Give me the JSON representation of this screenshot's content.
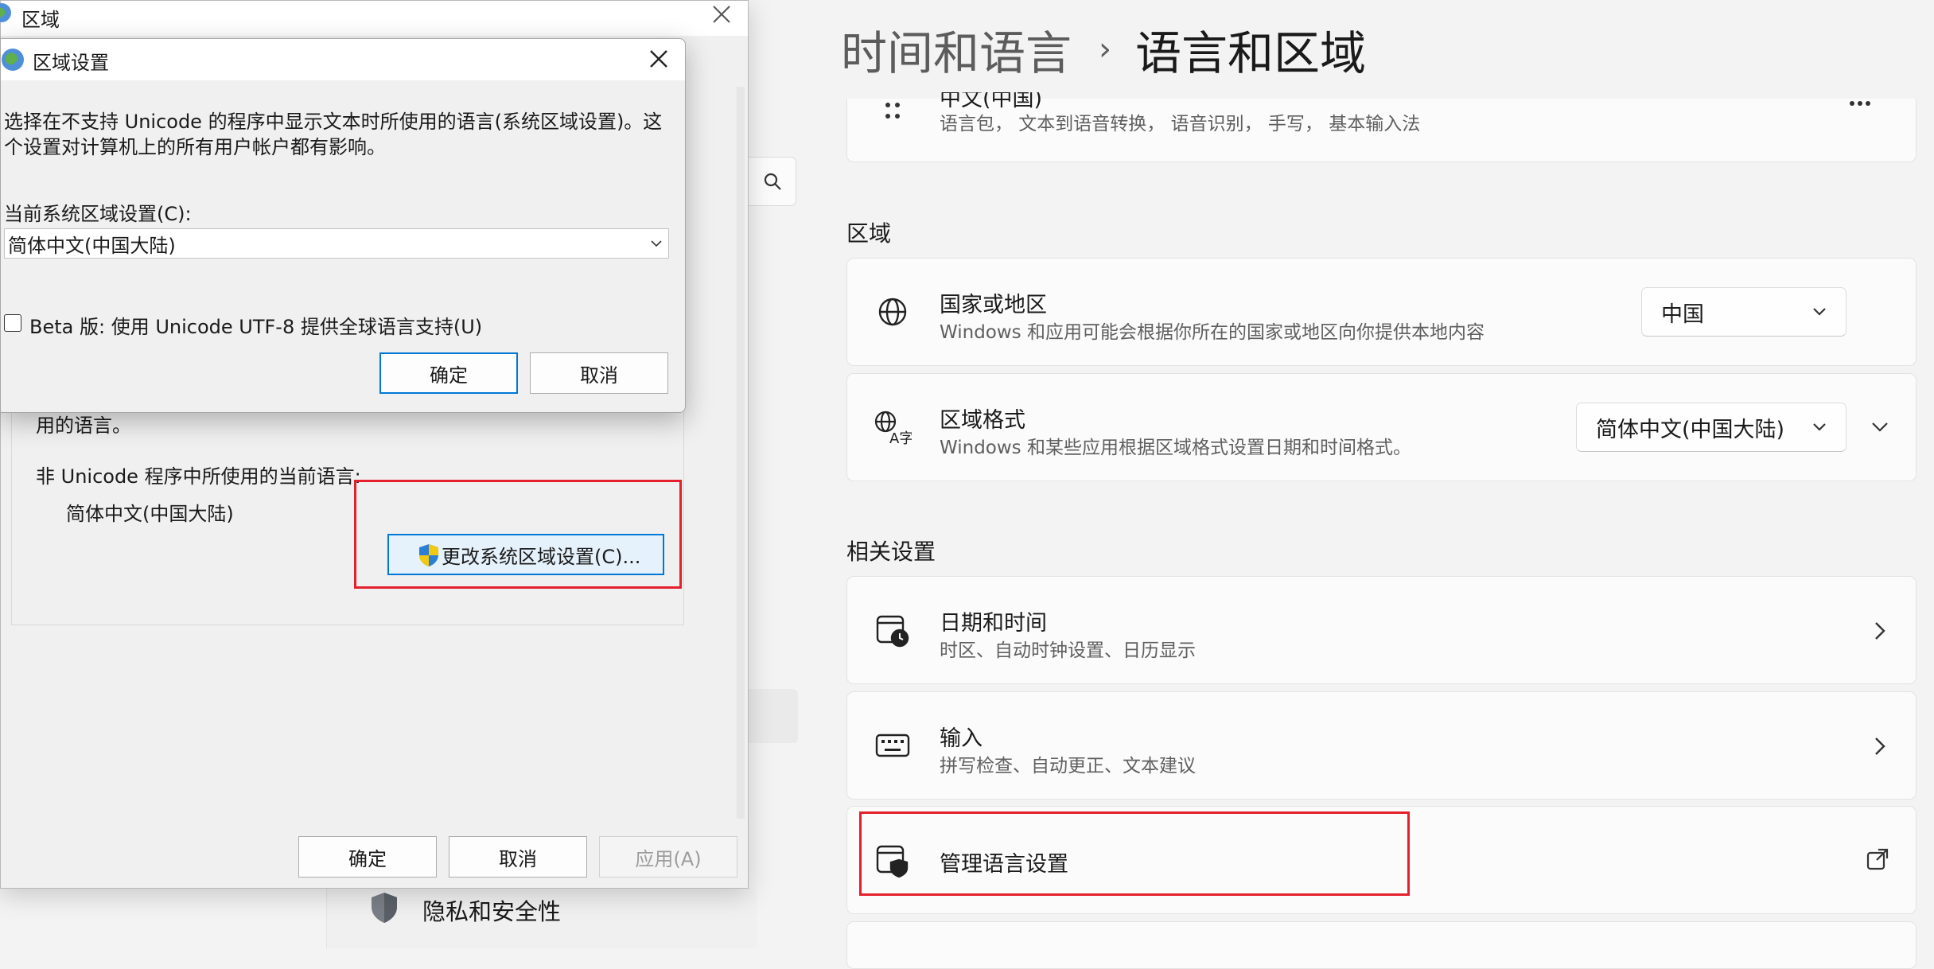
{
  "settings": {
    "breadcrumb": {
      "parent": "时间和语言",
      "separator": "›",
      "current": "语言和区域"
    },
    "language_card": {
      "title_partial": "中文(中国)",
      "subtitle": "语言包， 文本到语音转换， 语音识别， 手写， 基本输入法",
      "more_icon": "more-horizontal-icon"
    },
    "region_section_label": "区域",
    "country_card": {
      "title": "国家或地区",
      "subtitle": "Windows 和应用可能会根据你所在的国家或地区向你提供本地内容",
      "value": "中国"
    },
    "format_card": {
      "title": "区域格式",
      "subtitle": "Windows 和某些应用根据区域格式设置日期和时间格式。",
      "value": "简体中文(中国大陆)"
    },
    "related_section_label": "相关设置",
    "date_time_card": {
      "title": "日期和时间",
      "subtitle": "时区、自动时钟设置、日历显示"
    },
    "input_card": {
      "title": "输入",
      "subtitle": "拼写检查、自动更正、文本建议"
    },
    "manage_language_card": {
      "title": "管理语言设置"
    },
    "sidebar_privacy": "隐私和安全性"
  },
  "region_window": {
    "title": "区域",
    "partial_text": "用的语言。",
    "current_lang_label": "非 Unicode 程序中所使用的当前语言:",
    "current_lang_value": "简体中文(中国大陆)",
    "change_button": "更改系统区域设置(C)...",
    "ok": "确定",
    "cancel": "取消",
    "apply": "应用(A)"
  },
  "region_dialog": {
    "title": "区域设置",
    "description_line1": "选择在不支持 Unicode 的程序中显示文本时所使用的语言(系统区域设置)。这",
    "description_line2": "个设置对计算机上的所有用户帐户都有影响。",
    "current_label": "当前系统区域设置(C):",
    "current_value": "简体中文(中国大陆)",
    "beta_checkbox": "Beta 版: 使用 Unicode UTF-8 提供全球语言支持(U)",
    "ok": "确定",
    "cancel": "取消"
  },
  "colors": {
    "highlight_red": "#e3202c",
    "accent_blue": "#0078d7",
    "shield_yellow": "#f2c811",
    "shield_blue": "#2a7fd4"
  }
}
